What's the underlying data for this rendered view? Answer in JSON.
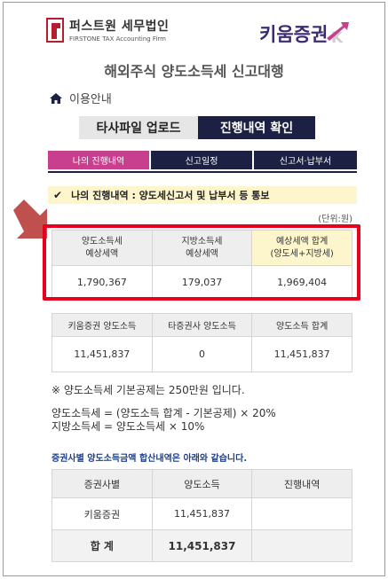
{
  "header": {
    "left_logo_main": "퍼스트원 세무법인",
    "left_logo_sub": "FIRSTONE TAX Accounting Firm",
    "right_logo": "키움증권",
    "right_logo_letter": "K",
    "page_title": "해외주식 양도소득세 신고대행"
  },
  "nav": {
    "home_label": "이용안내",
    "upload_button": "타사파일 업로드",
    "progress_button": "진행내역 확인",
    "tabs": [
      "나의 진행내역",
      "신고일정",
      "신고서·납부서"
    ]
  },
  "notice": {
    "text": "나의 진행내역 : 양도세신고서 및 납부서 등 통보",
    "unit": "(단위:원)"
  },
  "tax_table": {
    "headers": [
      [
        "양도소득세",
        "예상세액"
      ],
      [
        "지방소득세",
        "예상세액"
      ],
      [
        "예상세액 합계",
        "(양도세+지방세)"
      ]
    ],
    "values": [
      "1,790,367",
      "179,037",
      "1,969,404"
    ]
  },
  "income_table": {
    "headers": [
      "키움증권 양도소득",
      "타증권사 양도소득",
      "양도소득 합계"
    ],
    "values": [
      "11,451,837",
      "0",
      "11,451,837"
    ]
  },
  "notes": {
    "deduction": "※ 양도소득세 기본공제는 250만원 입니다.",
    "formula1": "양도소득세 = (양도소득 합계 - 기본공제) × 20%",
    "formula2": "지방소득세 = 양도소득세 × 10%"
  },
  "broker_section": {
    "heading": "증권사별 양도소득금액 합산내역은 아래와 같습니다.",
    "headers": [
      "증권사별",
      "양도소득",
      "진행내역"
    ],
    "rows": [
      {
        "broker": "키움증권",
        "income": "11,451,837",
        "status": ""
      }
    ],
    "total": {
      "label": "합 계",
      "income": "11,451,837",
      "status": ""
    }
  },
  "colors": {
    "navy": "#1c2143",
    "pink_tab": "#c73f8d",
    "highlight_red": "#e8001c",
    "notice_bg": "#fdf6cc"
  }
}
